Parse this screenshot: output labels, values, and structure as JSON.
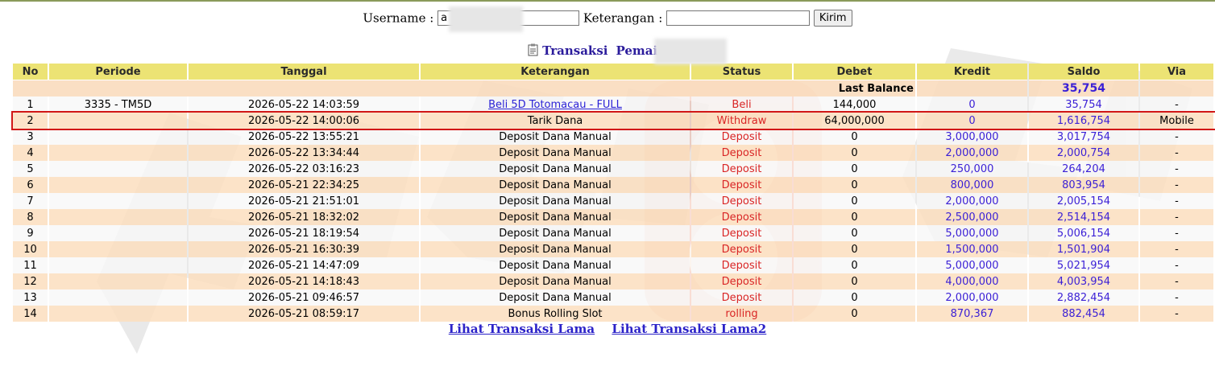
{
  "form": {
    "username_label": "Username :",
    "username_value": "a",
    "keterangan_label": "Keterangan :",
    "keterangan_value": "",
    "submit_label": "Kirim"
  },
  "title": {
    "transaksi": "Transaksi",
    "pemain_label": "Pemain : a"
  },
  "table": {
    "columns": [
      "No",
      "Periode",
      "Tanggal",
      "Keterangan",
      "Status",
      "Debet",
      "Kredit",
      "Saldo",
      "Via"
    ],
    "last_balance_label": "Last Balance",
    "last_balance_value": "35,754",
    "rows": [
      {
        "no": "1",
        "periode": "3335 - TM5D",
        "tanggal": "2026-05-22 14:03:59",
        "keterangan": "Beli 5D Totomacau - FULL",
        "status": "Beli",
        "debet": "144,000",
        "kredit": "0",
        "saldo": "35,754",
        "via": "-"
      },
      {
        "no": "2",
        "periode": "",
        "tanggal": "2026-05-22 14:00:06",
        "keterangan": "Tarik Dana",
        "status": "Withdraw",
        "debet": "64,000,000",
        "kredit": "0",
        "saldo": "1,616,754",
        "via": "Mobile"
      },
      {
        "no": "3",
        "periode": "",
        "tanggal": "2026-05-22 13:55:21",
        "keterangan": "Deposit Dana Manual",
        "status": "Deposit",
        "debet": "0",
        "kredit": "3,000,000",
        "saldo": "3,017,754",
        "via": "-"
      },
      {
        "no": "4",
        "periode": "",
        "tanggal": "2026-05-22 13:34:44",
        "keterangan": "Deposit Dana Manual",
        "status": "Deposit",
        "debet": "0",
        "kredit": "2,000,000",
        "saldo": "2,000,754",
        "via": "-"
      },
      {
        "no": "5",
        "periode": "",
        "tanggal": "2026-05-22 03:16:23",
        "keterangan": "Deposit Dana Manual",
        "status": "Deposit",
        "debet": "0",
        "kredit": "250,000",
        "saldo": "264,204",
        "via": "-"
      },
      {
        "no": "6",
        "periode": "",
        "tanggal": "2026-05-21 22:34:25",
        "keterangan": "Deposit Dana Manual",
        "status": "Deposit",
        "debet": "0",
        "kredit": "800,000",
        "saldo": "803,954",
        "via": "-"
      },
      {
        "no": "7",
        "periode": "",
        "tanggal": "2026-05-21 21:51:01",
        "keterangan": "Deposit Dana Manual",
        "status": "Deposit",
        "debet": "0",
        "kredit": "2,000,000",
        "saldo": "2,005,154",
        "via": "-"
      },
      {
        "no": "8",
        "periode": "",
        "tanggal": "2026-05-21 18:32:02",
        "keterangan": "Deposit Dana Manual",
        "status": "Deposit",
        "debet": "0",
        "kredit": "2,500,000",
        "saldo": "2,514,154",
        "via": "-"
      },
      {
        "no": "9",
        "periode": "",
        "tanggal": "2026-05-21 18:19:54",
        "keterangan": "Deposit Dana Manual",
        "status": "Deposit",
        "debet": "0",
        "kredit": "5,000,000",
        "saldo": "5,006,154",
        "via": "-"
      },
      {
        "no": "10",
        "periode": "",
        "tanggal": "2026-05-21 16:30:39",
        "keterangan": "Deposit Dana Manual",
        "status": "Deposit",
        "debet": "0",
        "kredit": "1,500,000",
        "saldo": "1,501,904",
        "via": "-"
      },
      {
        "no": "11",
        "periode": "",
        "tanggal": "2026-05-21 14:47:09",
        "keterangan": "Deposit Dana Manual",
        "status": "Deposit",
        "debet": "0",
        "kredit": "5,000,000",
        "saldo": "5,021,954",
        "via": "-"
      },
      {
        "no": "12",
        "periode": "",
        "tanggal": "2026-05-21 14:18:43",
        "keterangan": "Deposit Dana Manual",
        "status": "Deposit",
        "debet": "0",
        "kredit": "4,000,000",
        "saldo": "4,003,954",
        "via": "-"
      },
      {
        "no": "13",
        "periode": "",
        "tanggal": "2026-05-21 09:46:57",
        "keterangan": "Deposit Dana Manual",
        "status": "Deposit",
        "debet": "0",
        "kredit": "2,000,000",
        "saldo": "2,882,454",
        "via": "-"
      },
      {
        "no": "14",
        "periode": "",
        "tanggal": "2026-05-21 08:59:17",
        "keterangan": "Bonus Rolling Slot",
        "status": "rolling",
        "debet": "0",
        "kredit": "870,367",
        "saldo": "882,454",
        "via": "-"
      }
    ]
  },
  "links": {
    "old": "Lihat Transaksi Lama",
    "old2": "Lihat Transaksi Lama2"
  },
  "colors": {
    "header_bg": "#ece374",
    "row_alt_bg": "#fcdebe",
    "highlight_border": "#d11717",
    "status_red": "#d92525",
    "amount_blue": "#3a1fd6"
  }
}
